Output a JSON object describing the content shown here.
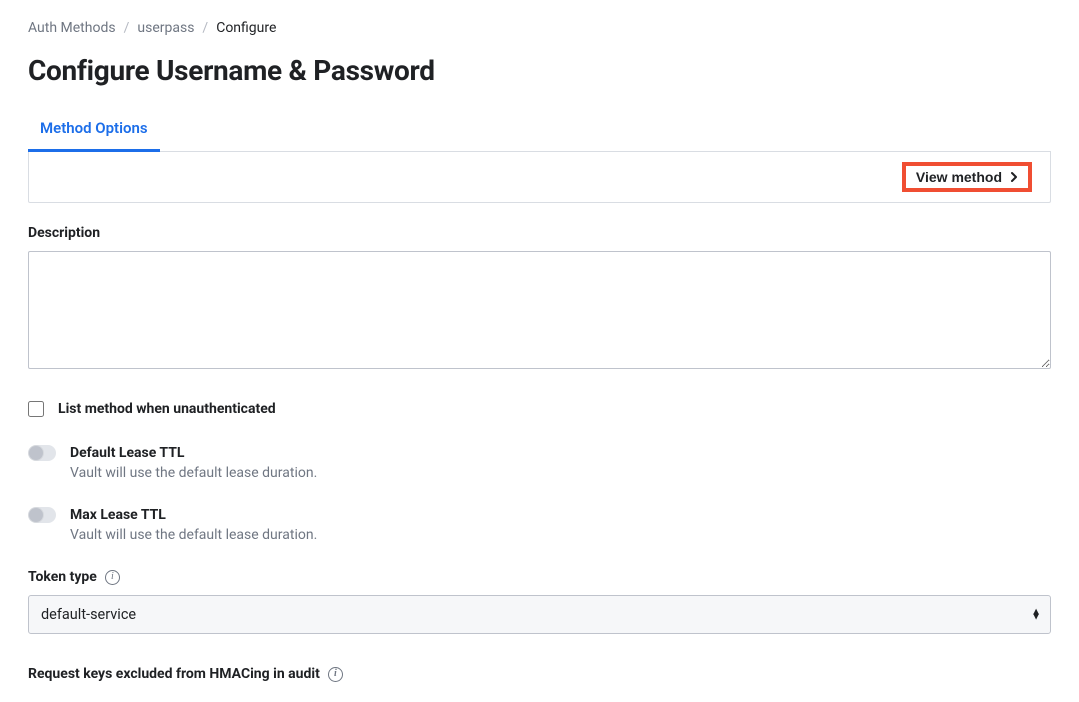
{
  "breadcrumb": {
    "items": [
      {
        "label": "Auth Methods"
      },
      {
        "label": "userpass"
      },
      {
        "label": "Configure"
      }
    ]
  },
  "page_title": "Configure Username & Password",
  "tabs": {
    "method_options": "Method Options"
  },
  "toolbar": {
    "view_method": "View method"
  },
  "form": {
    "description_label": "Description",
    "description_value": "",
    "list_unauth_label": "List method when unauthenticated",
    "default_lease": {
      "label": "Default Lease TTL",
      "help": "Vault will use the default lease duration."
    },
    "max_lease": {
      "label": "Max Lease TTL",
      "help": "Vault will use the default lease duration."
    },
    "token_type": {
      "label": "Token type",
      "value": "default-service"
    },
    "audit_keys_label": "Request keys excluded from HMACing in audit"
  }
}
